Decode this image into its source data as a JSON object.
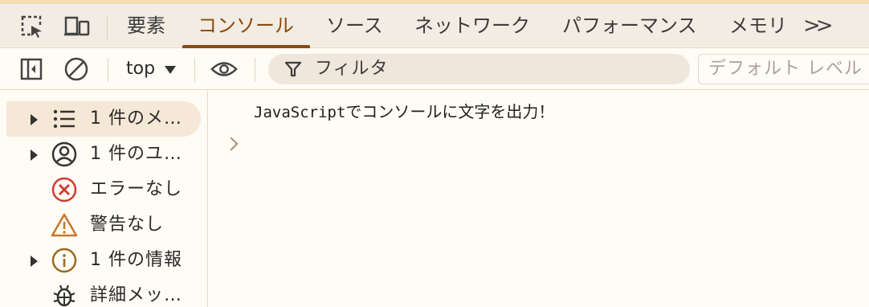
{
  "tabs": [
    {
      "label": "要素",
      "active": false
    },
    {
      "label": "コンソール",
      "active": true
    },
    {
      "label": "ソース",
      "active": false
    },
    {
      "label": "ネットワーク",
      "active": false
    },
    {
      "label": "パフォーマンス",
      "active": false
    },
    {
      "label": "メモリ",
      "active": false
    }
  ],
  "tab_more_label": ">>",
  "toolbar": {
    "context_label": "top",
    "filter_placeholder": "フィルタ",
    "levels_label": "デフォルト レベル"
  },
  "sidebar": {
    "items": [
      {
        "label": "1 件のメ…",
        "icon": "list-icon",
        "expandable": true,
        "selected": true
      },
      {
        "label": "1 件のユ…",
        "icon": "user-icon",
        "expandable": true,
        "selected": false
      },
      {
        "label": "エラーなし",
        "icon": "error-icon",
        "expandable": false,
        "selected": false
      },
      {
        "label": "警告なし",
        "icon": "warning-icon",
        "expandable": false,
        "selected": false
      },
      {
        "label": "1 件の情報",
        "icon": "info-icon",
        "expandable": true,
        "selected": false
      },
      {
        "label": "詳細メッ…",
        "icon": "bug-icon",
        "expandable": false,
        "selected": false
      }
    ]
  },
  "console": {
    "message_mono": "JavaScript",
    "message_rest": "でコンソールに文字を出力！"
  },
  "colors": {
    "accent": "#8a4a12",
    "error": "#d13b2f",
    "warning": "#c8762a",
    "info": "#9c6a1f",
    "selected_bg": "#f6e8d6"
  }
}
